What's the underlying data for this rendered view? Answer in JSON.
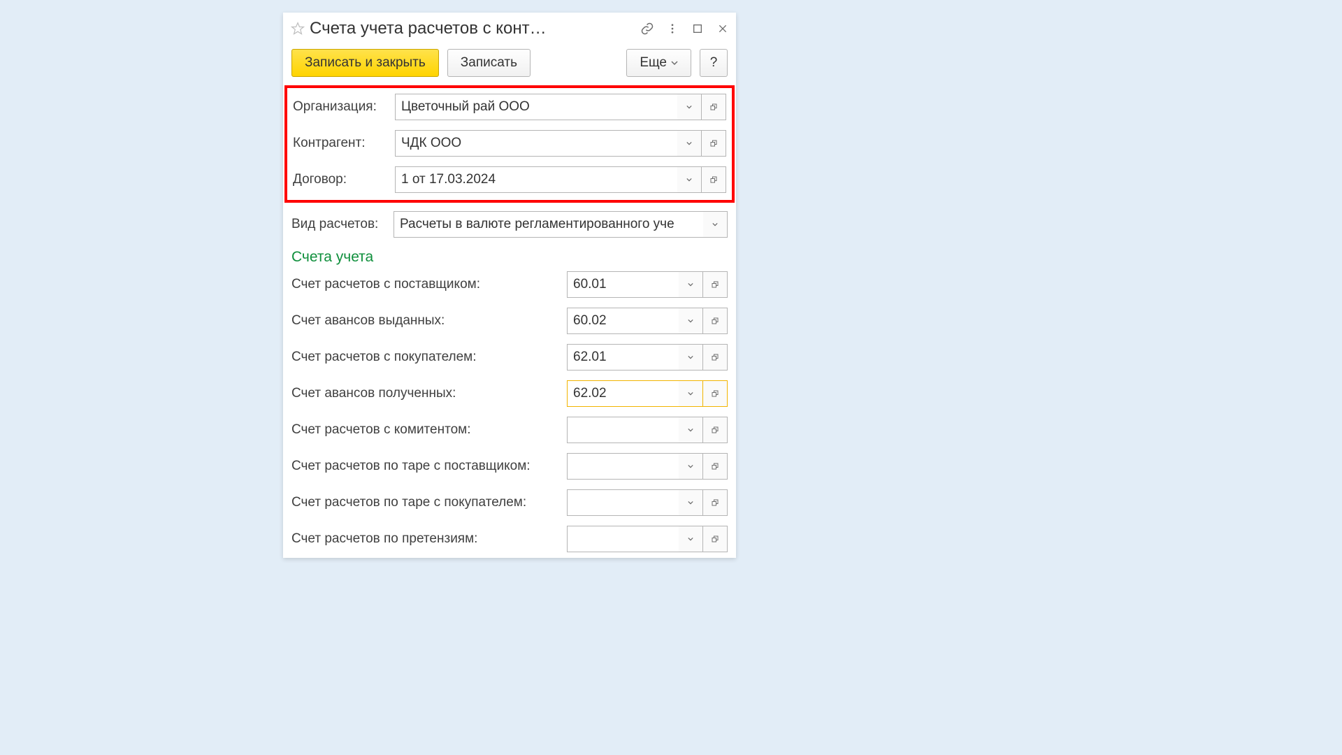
{
  "title": "Счета учета расчетов с конт…",
  "toolbar": {
    "save_close_label": "Записать и закрыть",
    "save_label": "Записать",
    "more_label": "Еще",
    "help_label": "?"
  },
  "fields": {
    "organization_label": "Организация:",
    "organization_value": "Цветочный рай ООО",
    "counterparty_label": "Контрагент:",
    "counterparty_value": "ЧДК ООО",
    "contract_label": "Договор:",
    "contract_value": "1 от 17.03.2024",
    "settlement_type_label": "Вид расчетов:",
    "settlement_type_value": "Расчеты в валюте регламентированного уче"
  },
  "section_title": "Счета учета",
  "accounts": [
    {
      "label": "Счет расчетов с поставщиком:",
      "value": "60.01",
      "active": false
    },
    {
      "label": "Счет авансов выданных:",
      "value": "60.02",
      "active": false
    },
    {
      "label": "Счет расчетов с покупателем:",
      "value": "62.01",
      "active": false
    },
    {
      "label": "Счет авансов полученных:",
      "value": "62.02",
      "active": true
    },
    {
      "label": "Счет расчетов с комитентом:",
      "value": "",
      "active": false
    },
    {
      "label": "Счет расчетов по таре с поставщиком:",
      "value": "",
      "active": false
    },
    {
      "label": "Счет расчетов по таре с покупателем:",
      "value": "",
      "active": false
    },
    {
      "label": "Счет расчетов по претензиям:",
      "value": "",
      "active": false
    }
  ]
}
